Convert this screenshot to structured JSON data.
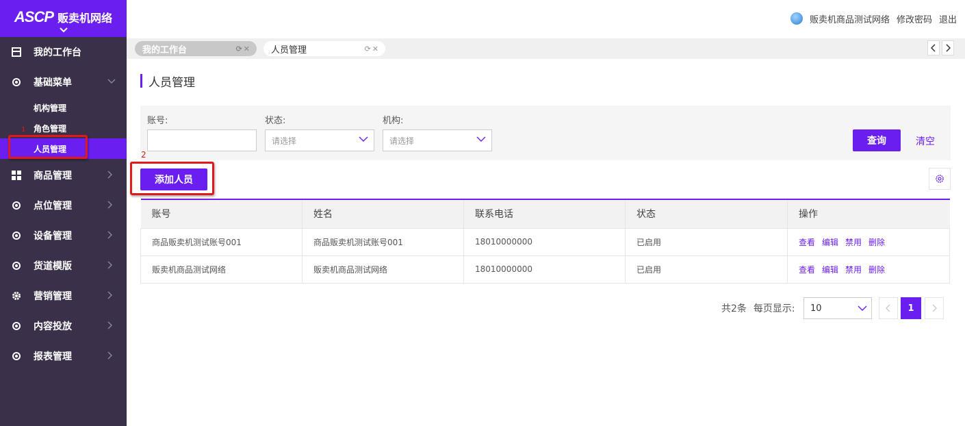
{
  "brand": {
    "logo_mark": "ASCP",
    "name": "贩卖机网络"
  },
  "colors": {
    "primary": "#6b1ef0",
    "sidebar_bg": "#3a3049",
    "highlight": "#e01a1a"
  },
  "sidebar": {
    "items": [
      {
        "label": "我的工作台",
        "icon": "calendar-icon"
      },
      {
        "label": "基础菜单",
        "icon": "circle-icon",
        "expanded": true,
        "children": [
          {
            "label": "机构管理"
          },
          {
            "label": "角色管理"
          },
          {
            "label": "人员管理",
            "active": true
          }
        ]
      },
      {
        "label": "商品管理",
        "icon": "grid-icon"
      },
      {
        "label": "点位管理",
        "icon": "circle-icon"
      },
      {
        "label": "设备管理",
        "icon": "circle-icon"
      },
      {
        "label": "货道模版",
        "icon": "circle-icon"
      },
      {
        "label": "营销管理",
        "icon": "gear-icon"
      },
      {
        "label": "内容投放",
        "icon": "circle-icon"
      },
      {
        "label": "报表管理",
        "icon": "circle-icon"
      }
    ]
  },
  "header": {
    "user": "贩卖机商品测试网络",
    "change_password": "修改密码",
    "logout": "退出"
  },
  "tabs": [
    {
      "label": "我的工作台"
    },
    {
      "label": "人员管理"
    }
  ],
  "page": {
    "title": "人员管理"
  },
  "filter": {
    "account_label": "账号:",
    "account_value": "",
    "status_label": "状态:",
    "status_placeholder": "请选择",
    "org_label": "机构:",
    "org_placeholder": "请选择",
    "query_button": "查询",
    "clear_button": "清空"
  },
  "annotations": {
    "label_1": "1",
    "label_2": "2"
  },
  "actions": {
    "add_button": "添加人员"
  },
  "table": {
    "columns": [
      "账号",
      "姓名",
      "联系电话",
      "状态",
      "操作"
    ],
    "rows": [
      {
        "account": "商品贩卖机测试账号001",
        "name": "商品贩卖机测试账号001",
        "phone": "18010000000",
        "status": "已启用"
      },
      {
        "account": "贩卖机商品测试网络",
        "name": "贩卖机商品测试网络",
        "phone": "18010000000",
        "status": "已启用"
      }
    ],
    "ops": [
      "查看",
      "编辑",
      "禁用",
      "删除"
    ]
  },
  "pagination": {
    "total": "共2条",
    "page_size_label": "每页显示:",
    "page_size": "10",
    "current_page": "1"
  }
}
